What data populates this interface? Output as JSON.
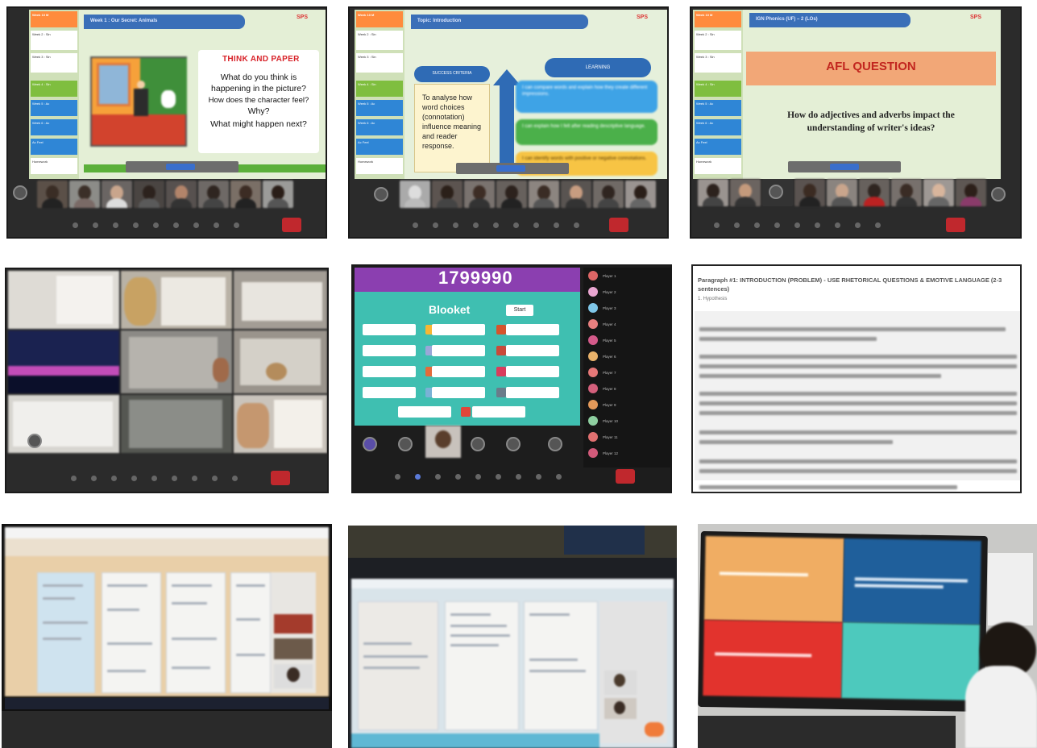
{
  "panel1": {
    "topbar": "Week 1 : Our Secret: Animals",
    "logo": "SPS",
    "lesson_items": [
      "Week 10 M",
      "Week 2 : Sin",
      "Week 3 : Sin",
      "Week 4 : Sin",
      "Week 5 : Ac",
      "Week 6 : Ac",
      "Ac Feel",
      "Homework"
    ],
    "think_title": "THINK AND PAPER",
    "question_lines": [
      "What do you think is",
      "happening in the picture?",
      "How does the character feel?",
      "Why?",
      "What might happen next?"
    ]
  },
  "panel2": {
    "topbar": "Topic: Introduction",
    "left_header": "SUCCESS CRITERIA",
    "left_text": [
      "To analyse how",
      "word choices",
      "(connotation)",
      "influence meaning",
      "and reader",
      "response."
    ],
    "right_header": "LEARNING",
    "criteria": [
      "I can compare words and explain how they create different impressions.",
      "I can explain how I felt after reading descriptive language.",
      "I can identify words with positive or negative connotations."
    ]
  },
  "panel3": {
    "topbar": "IGN Phonics (UF) – 2 (LOs)",
    "logo": "SPS",
    "afl_title": "AFL QUESTION",
    "question_lines": [
      "How do adjectives and adverbs impact the",
      "understanding of writer's ideas?"
    ]
  },
  "panel5": {
    "score": "1799990",
    "game_title": "Blooket",
    "start_label": "Start",
    "players": [
      "Player 1",
      "Player 2",
      "Player 3",
      "Player 4",
      "Player 5",
      "Player 6",
      "Player 7",
      "Player 8",
      "Player 9",
      "Player 10",
      "Player 11",
      "Player 12"
    ]
  },
  "panel6": {
    "heading": "Paragraph #1: INTRODUCTION (PROBLEM) - USE RHETORICAL QUESTIONS & EMOTIVE LANGUAGE (2-3 sentences)",
    "subheading": "1. Hypothesis"
  },
  "colors": {
    "meeting_bg": "#2b2b2b",
    "slide_bg": "#e4efd6",
    "blooket_teal": "#3fbfb1",
    "blooket_purple": "#8b3fb0",
    "end_call": "#c0282d",
    "accent_blue": "#3a6fb8",
    "afl_orange": "#f2a777"
  }
}
